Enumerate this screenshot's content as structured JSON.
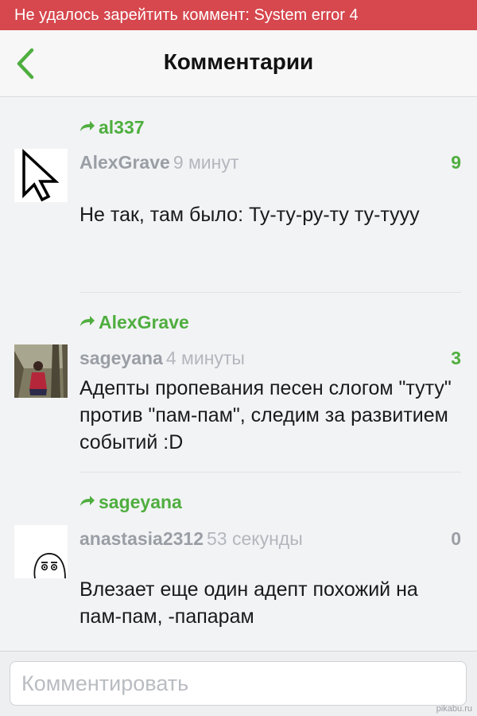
{
  "error_banner": {
    "text": "Не удалось зарейтить коммент: System error 4"
  },
  "navbar": {
    "back_icon": "chevron-left-icon",
    "title": "Комментарии"
  },
  "colors": {
    "accent": "#4fae3f",
    "error": "#d6474e",
    "rating_positive": "#4fae3f",
    "rating_zero": "#9a9ea5"
  },
  "comments": [
    {
      "reply_to": "al337",
      "author": "AlexGrave",
      "time": "9 минут",
      "rating": "9",
      "text": "Не так, там было: Ту-ту-ру-ту ту-тууу",
      "avatar": "cursor-arrow-avatar"
    },
    {
      "reply_to": "AlexGrave",
      "author": "sageyana",
      "time": "4 минуты",
      "rating": "3",
      "text": "Адепты пропевания песен слогом \"туту\" против \"пам-пам\", следим за развитием событий :D",
      "avatar": "photo-avatar"
    },
    {
      "reply_to": "sageyana",
      "author": "anastasia2312",
      "time": "53 секунды",
      "rating": "0",
      "text": "Влезает еще один адепт похожий на пам-пам, -папарам",
      "avatar": "cartoon-face-avatar"
    }
  ],
  "composer": {
    "placeholder": "Комментировать"
  },
  "watermark": {
    "text": "pikabu.ru"
  }
}
